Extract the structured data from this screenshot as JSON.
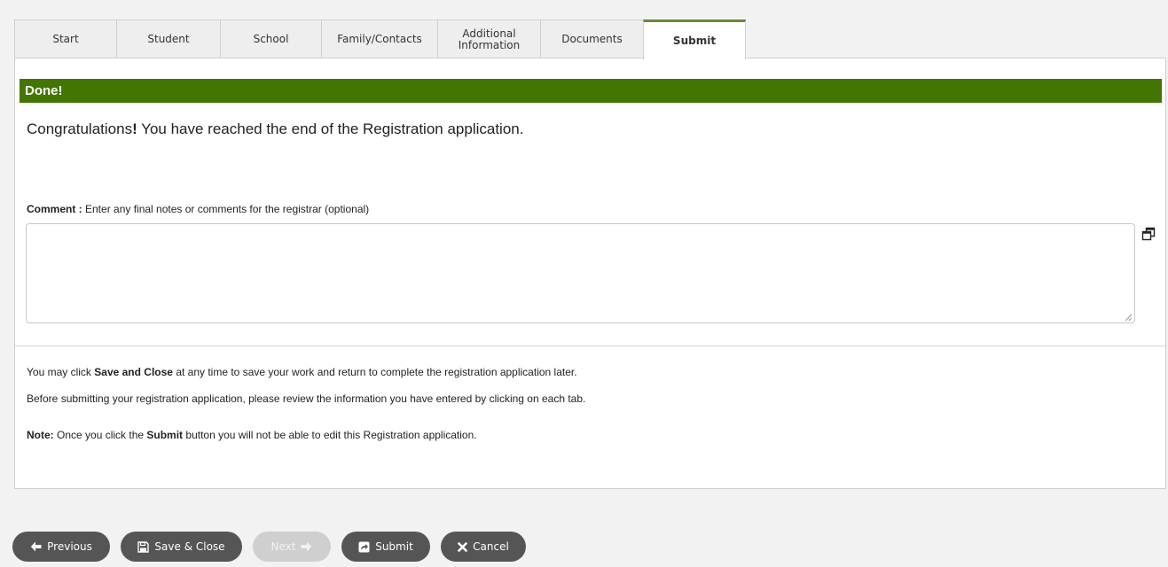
{
  "tabs": [
    {
      "label": "Start",
      "sub": ""
    },
    {
      "label": "Student",
      "sub": ""
    },
    {
      "label": "School",
      "sub": ""
    },
    {
      "label": "Family/Contacts",
      "sub": ""
    },
    {
      "label": "Additional",
      "sub": "Information"
    },
    {
      "label": "Documents",
      "sub": ""
    },
    {
      "label": "Submit",
      "sub": ""
    }
  ],
  "active_tab": "Submit",
  "done": {
    "title": "Done!"
  },
  "congrats": {
    "pre": "Congratulations",
    "bang": "!",
    "post": " You have reached the end of the Registration application."
  },
  "comment": {
    "label": "Comment :",
    "hint": " Enter any final notes or comments for the registrar (optional)",
    "value": "",
    "placeholder": ""
  },
  "info": {
    "line1_pre": "You may click ",
    "line1_bold": "Save and Close",
    "line1_post": " at any time to save your work and return to complete the registration application later.",
    "line2": "Before submitting your registration application, please review the information you have entered by clicking on each tab.",
    "line3_note": "Note:",
    "line3_mid": " Once you click the ",
    "line3_bold": "Submit",
    "line3_post": " button you will not be able to edit this Registration application."
  },
  "buttons": {
    "previous": "Previous",
    "save_close": "Save & Close",
    "next": "Next",
    "submit": "Submit",
    "cancel": "Cancel"
  },
  "colors": {
    "done_bar": "#437503",
    "active_tab_accent": "#6a8a32",
    "button_bg": "#555555",
    "button_disabled_bg": "#cfcfcf"
  },
  "icons": {
    "previous": "arrow-left-icon",
    "save_close": "floppy-disk-icon",
    "next": "arrow-right-icon",
    "submit": "share-arrow-icon",
    "cancel": "x-icon",
    "expand": "window-restore-icon"
  }
}
